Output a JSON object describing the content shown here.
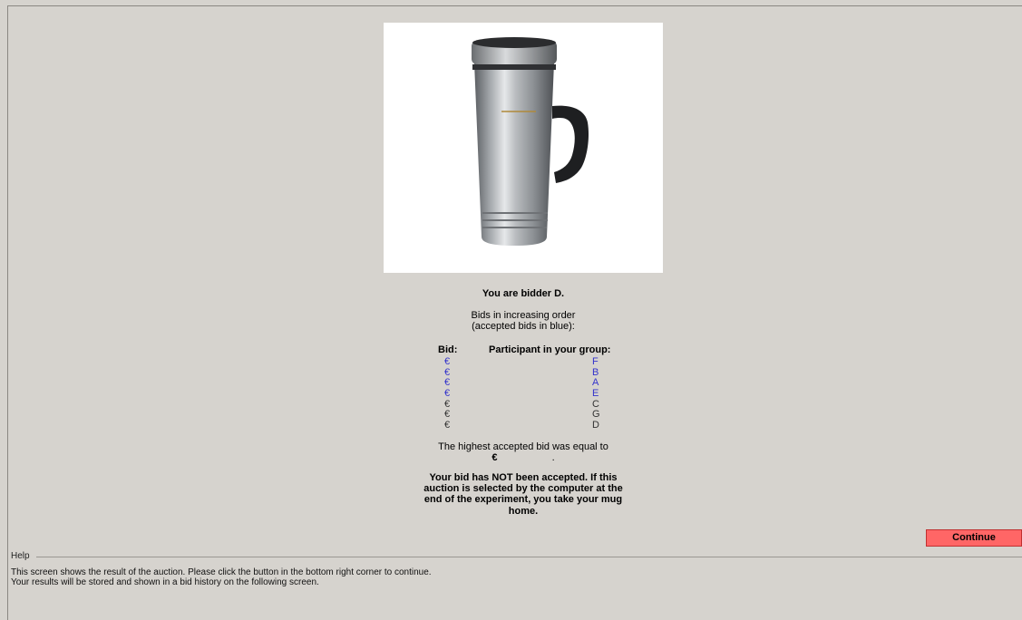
{
  "bidder_line": "You are bidder D.",
  "order_heading": [
    "Bids in increasing order",
    "(accepted bids in blue):"
  ],
  "columns": {
    "bid": "Bid:",
    "participant": "Participant in your group:"
  },
  "bids": [
    {
      "currency": "€",
      "participant": "F",
      "accepted": true
    },
    {
      "currency": "€",
      "participant": "B",
      "accepted": true
    },
    {
      "currency": "€",
      "participant": "A",
      "accepted": true
    },
    {
      "currency": "€",
      "participant": "E",
      "accepted": true
    },
    {
      "currency": "€",
      "participant": "C",
      "accepted": false
    },
    {
      "currency": "€",
      "participant": "G",
      "accepted": false
    },
    {
      "currency": "€",
      "participant": "D",
      "accepted": false
    }
  ],
  "highest_line": "The highest accepted bid was equal to",
  "highest_amount": "€",
  "highest_suffix": ".",
  "result_message": "Your bid has NOT been accepted. If this auction is selected by the computer at the end of the experiment, you take your mug home.",
  "continue_label": "Continue",
  "help": {
    "label": "Help",
    "lines": [
      "This screen shows the result of the auction. Please click the button in the bottom right corner to continue.",
      "Your results will be stored and shown in a bid history on the following screen."
    ]
  },
  "colors": {
    "accepted": "#3333cc",
    "rejected": "#333333",
    "button": "#ff6666",
    "background": "#d6d3ce"
  },
  "icons": {
    "product": "travel-mug-image"
  }
}
